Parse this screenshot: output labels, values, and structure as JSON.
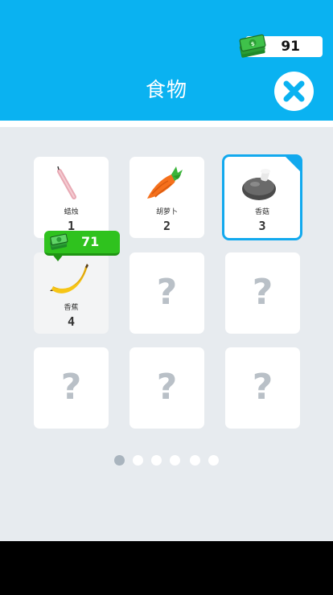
{
  "header": {
    "currency_amount": "91",
    "title": "食物",
    "close_icon": "close-icon",
    "cash_icon": "cash-stack-icon"
  },
  "colors": {
    "header_bg": "#0ab2f1",
    "main_bg": "#e7ebef",
    "accent": "#12a9ee",
    "price_green": "#2fc21e"
  },
  "grid": {
    "items": [
      {
        "label": "蜡烛",
        "level": "1",
        "icon": "candle-icon",
        "state": "unlocked"
      },
      {
        "label": "胡萝卜",
        "level": "2",
        "icon": "carrot-icon",
        "state": "unlocked"
      },
      {
        "label": "香菇",
        "level": "3",
        "icon": "mushroom-icon",
        "state": "selected"
      },
      {
        "label": "香蕉",
        "level": "4",
        "icon": "banana-icon",
        "state": "purchasable",
        "price": "71"
      },
      {
        "label": "?",
        "state": "locked"
      },
      {
        "label": "?",
        "state": "locked"
      },
      {
        "label": "?",
        "state": "locked"
      },
      {
        "label": "?",
        "state": "locked"
      },
      {
        "label": "?",
        "state": "locked"
      }
    ]
  },
  "pagination": {
    "pages": 6,
    "active_page": 1
  }
}
